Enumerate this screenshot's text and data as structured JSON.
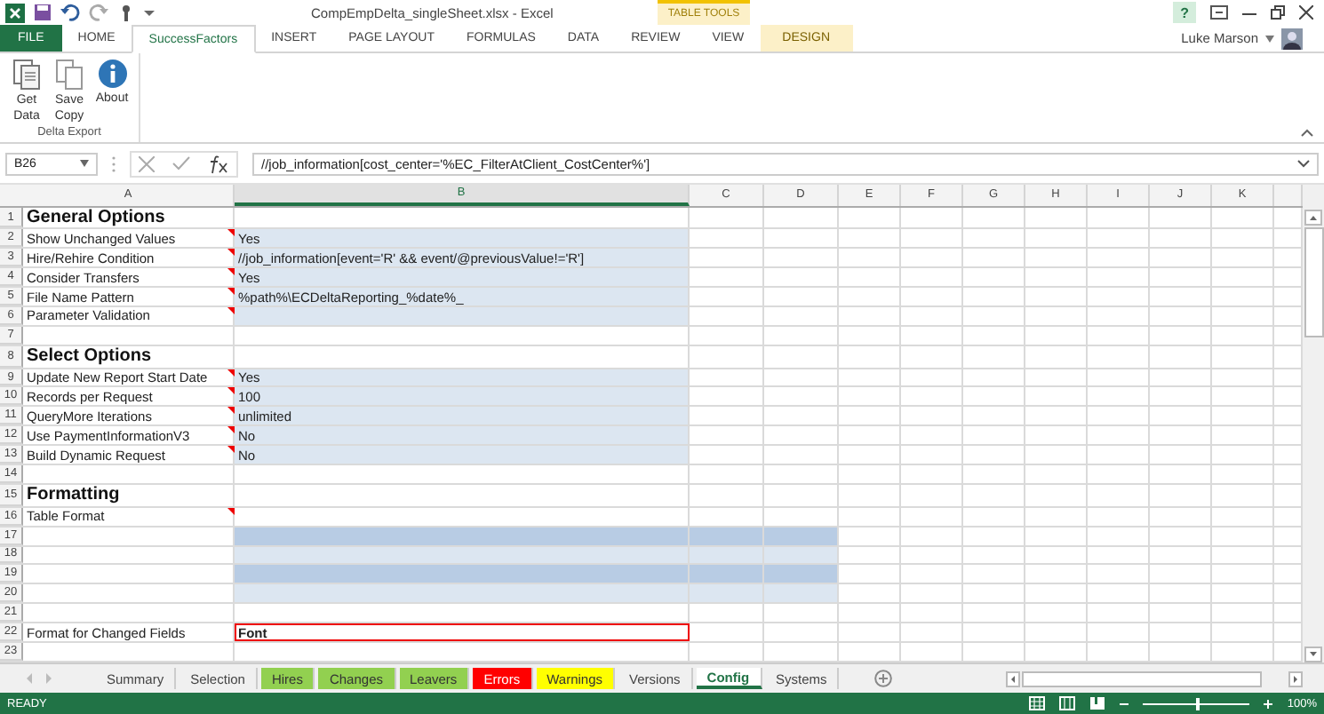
{
  "window": {
    "title": "CompEmpDelta_singleSheet.xlsx - Excel",
    "contextual_group": "TABLE TOOLS",
    "user": "Luke Marson",
    "help": "?"
  },
  "ribbon_tabs": [
    {
      "label": "FILE",
      "kind": "file",
      "selected": false
    },
    {
      "label": "HOME",
      "kind": "tab",
      "selected": false
    },
    {
      "label": "SuccessFactors",
      "kind": "tab",
      "selected": true
    },
    {
      "label": "INSERT",
      "kind": "tab",
      "selected": false
    },
    {
      "label": "PAGE LAYOUT",
      "kind": "tab",
      "selected": false
    },
    {
      "label": "FORMULAS",
      "kind": "tab",
      "selected": false
    },
    {
      "label": "DATA",
      "kind": "tab",
      "selected": false
    },
    {
      "label": "REVIEW",
      "kind": "tab",
      "selected": false
    },
    {
      "label": "VIEW",
      "kind": "tab",
      "selected": false
    },
    {
      "label": "DESIGN",
      "kind": "contextual",
      "selected": false
    }
  ],
  "ribbon_group": {
    "label": "Delta Export",
    "buttons": [
      {
        "label": "Get Data",
        "kind": "document"
      },
      {
        "label": "Save Copy",
        "kind": "copy"
      },
      {
        "label": "About",
        "kind": "info"
      }
    ]
  },
  "formula_bar": {
    "name_box": "B26",
    "formula": "//job_information[cost_center='%EC_FilterAtClient_CostCenter%']"
  },
  "columns": [
    {
      "label": "A",
      "selected": false
    },
    {
      "label": "B",
      "selected": true
    },
    {
      "label": "C",
      "selected": false
    },
    {
      "label": "D",
      "selected": false
    },
    {
      "label": "E",
      "selected": false
    },
    {
      "label": "F",
      "selected": false
    },
    {
      "label": "G",
      "selected": false
    },
    {
      "label": "H",
      "selected": false
    },
    {
      "label": "I",
      "selected": false
    },
    {
      "label": "J",
      "selected": false
    },
    {
      "label": "K",
      "selected": false
    }
  ],
  "rows": [
    {
      "number": "1",
      "kind": "heading",
      "a": "General Options",
      "comment": false
    },
    {
      "number": "2",
      "kind": "setting",
      "a": "Show Unchanged Values",
      "b": "Yes",
      "comment": true
    },
    {
      "number": "3",
      "kind": "setting",
      "a": "Hire/Rehire Condition",
      "b": "//job_information[event='R' && event/@previousValue!='R']",
      "comment": true
    },
    {
      "number": "4",
      "kind": "setting",
      "a": "Consider Transfers",
      "b": "Yes",
      "comment": true
    },
    {
      "number": "5",
      "kind": "setting",
      "a": "File Name Pattern",
      "b": "%path%\\ECDeltaReporting_%date%_",
      "comment": true
    },
    {
      "number": "6",
      "kind": "setting",
      "a": "Parameter Validation",
      "comment": true
    },
    {
      "number": "7",
      "kind": "blank",
      "comment": false
    },
    {
      "number": "8",
      "kind": "heading",
      "a": "Select Options",
      "comment": false
    },
    {
      "number": "9",
      "kind": "setting",
      "a": "Update New Report Start Date",
      "b": "Yes",
      "comment": true
    },
    {
      "number": "10",
      "kind": "setting",
      "a": "Records per Request",
      "b": "100",
      "comment": true
    },
    {
      "number": "11",
      "kind": "setting",
      "a": "QueryMore Iterations",
      "b": "unlimited",
      "comment": true
    },
    {
      "number": "12",
      "kind": "setting",
      "a": "Use PaymentInformationV3",
      "b": "No",
      "comment": true
    },
    {
      "number": "13",
      "kind": "setting",
      "a": "Build Dynamic Request",
      "b": "No",
      "comment": true
    },
    {
      "number": "14",
      "kind": "blank",
      "comment": false
    },
    {
      "number": "15",
      "kind": "heading",
      "a": "Formatting",
      "comment": false
    },
    {
      "number": "16",
      "kind": "label",
      "a": "Table Format",
      "comment": true
    },
    {
      "number": "17",
      "kind": "band",
      "dark": true,
      "comment": false
    },
    {
      "number": "18",
      "kind": "band",
      "dark": false,
      "comment": false
    },
    {
      "number": "19",
      "kind": "band",
      "dark": true,
      "comment": false
    },
    {
      "number": "20",
      "kind": "band",
      "dark": false,
      "comment": false
    },
    {
      "number": "21",
      "kind": "blank",
      "comment": false
    },
    {
      "number": "22",
      "kind": "format",
      "a": "Format for Changed Fields",
      "b": "Font",
      "comment": false
    },
    {
      "number": "23",
      "kind": "blank",
      "comment": false
    }
  ],
  "sheet_tabs": [
    {
      "label": "Summary",
      "selected": false
    },
    {
      "label": "Selection",
      "selected": false
    },
    {
      "label": "Hires",
      "color": "#92d050",
      "selected": false
    },
    {
      "label": "Changes",
      "color": "#92d050",
      "selected": false
    },
    {
      "label": "Leavers",
      "color": "#92d050",
      "selected": false
    },
    {
      "label": "Errors",
      "color": "#ff0000",
      "selected": false
    },
    {
      "label": "Warnings",
      "color": "#ffff00",
      "selected": false
    },
    {
      "label": "Versions",
      "selected": false
    },
    {
      "label": "Config",
      "selected": true
    },
    {
      "label": "Systems",
      "selected": false
    }
  ],
  "status_bar": {
    "status": "READY",
    "zoom": "100%",
    "zoom_slider": {
      "level": 0.5
    }
  }
}
